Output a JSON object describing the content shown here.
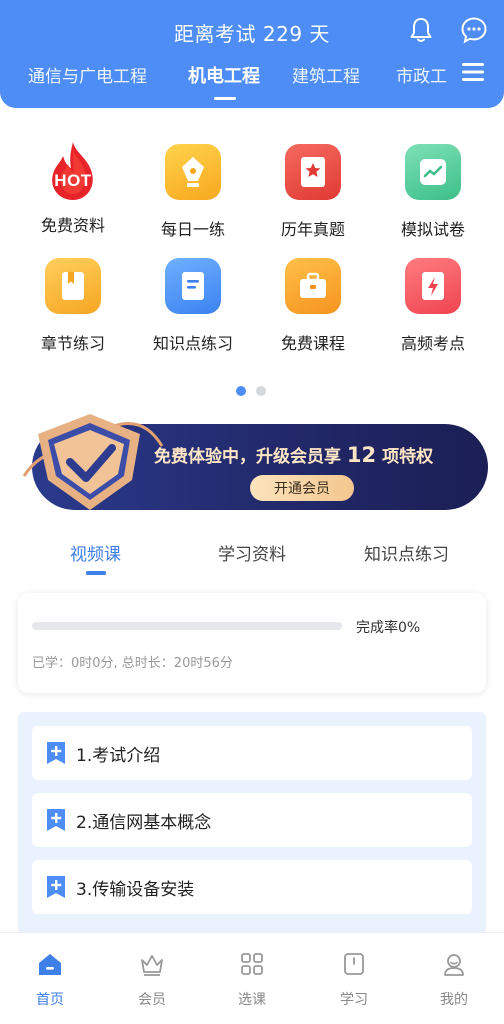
{
  "header": {
    "countdown": "距离考试 229 天",
    "tabs": [
      {
        "label": "通信与广电工程"
      },
      {
        "label": "机电工程"
      },
      {
        "label": "建筑工程"
      },
      {
        "label": "市政工"
      }
    ],
    "active_tab": "机电工程",
    "accent_color": "#4d8df5"
  },
  "grid": {
    "items": [
      {
        "label": "免费资料",
        "icon": "hot-flame-icon",
        "badge": "HOT"
      },
      {
        "label": "每日一练",
        "icon": "pen-nib-icon"
      },
      {
        "label": "历年真题",
        "icon": "star-bookmark-icon"
      },
      {
        "label": "模拟试卷",
        "icon": "chart-paper-icon"
      },
      {
        "label": "章节练习",
        "icon": "bookmark-book-icon"
      },
      {
        "label": "知识点练习",
        "icon": "document-icon"
      },
      {
        "label": "免费课程",
        "icon": "briefcase-icon"
      },
      {
        "label": "高频考点",
        "icon": "lightning-card-icon"
      }
    ],
    "pager": {
      "current": 1,
      "total": 2
    }
  },
  "banner": {
    "text_prefix": "免费体验中，升级会员享",
    "highlight": "12",
    "text_suffix": "项特权",
    "button_label": "开通会员"
  },
  "section_tabs": {
    "items": [
      {
        "label": "视频课"
      },
      {
        "label": "学习资料"
      },
      {
        "label": "知识点练习"
      }
    ],
    "active": "视频课"
  },
  "progress": {
    "completion_label": "完成率0%",
    "completion_fraction": 0,
    "study_info": "已学：0时0分, 总时长：20时56分"
  },
  "chapters": [
    {
      "title": "1.考试介绍"
    },
    {
      "title": "2.通信网基本概念"
    },
    {
      "title": "3.传输设备安装"
    }
  ],
  "bottom_nav": {
    "items": [
      {
        "label": "首页",
        "icon": "home-icon"
      },
      {
        "label": "会员",
        "icon": "crown-icon"
      },
      {
        "label": "选课",
        "icon": "grid-icon"
      },
      {
        "label": "学习",
        "icon": "book-icon"
      },
      {
        "label": "我的",
        "icon": "user-icon"
      }
    ],
    "active": "首页"
  }
}
